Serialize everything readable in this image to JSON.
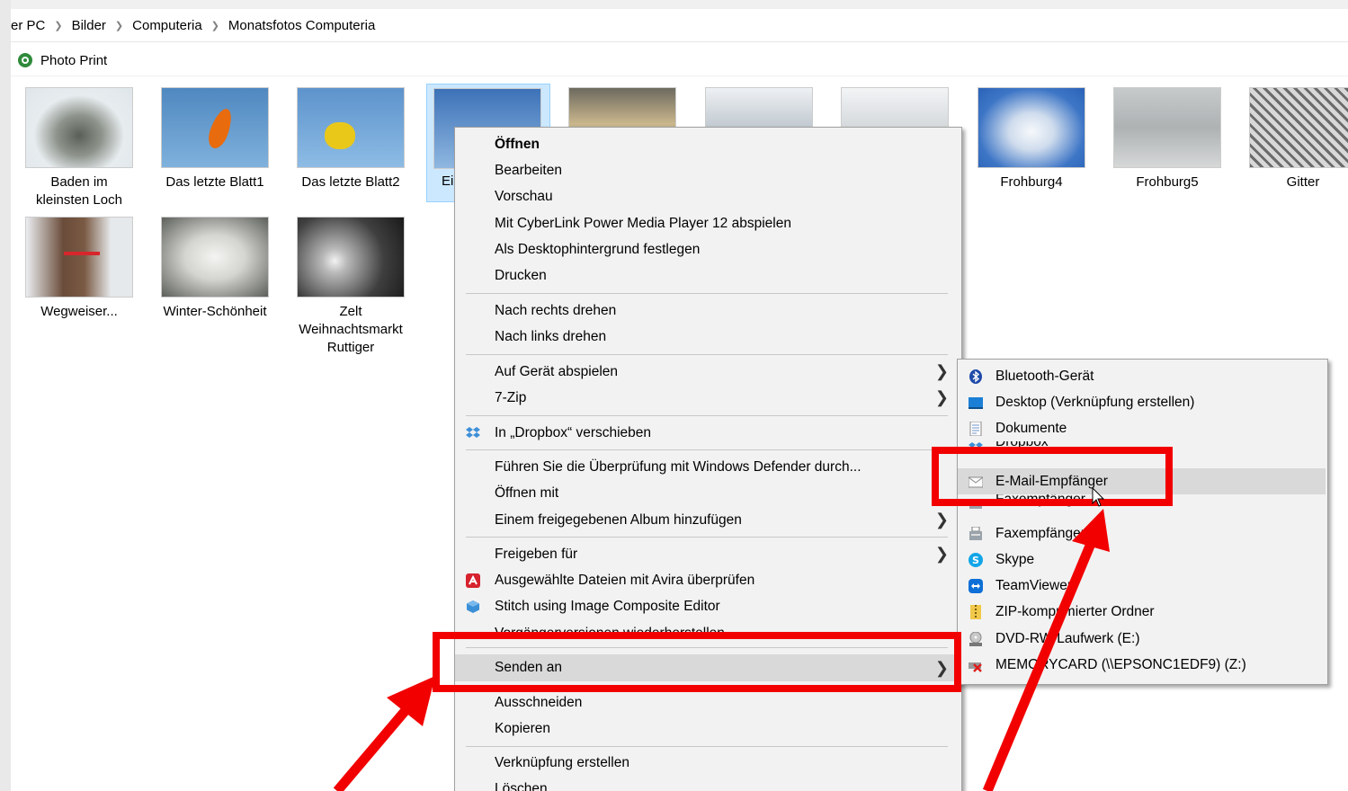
{
  "breadcrumb": [
    "er PC",
    "Bilder",
    "Computeria",
    "Monatsfotos Computeria"
  ],
  "toolbar": {
    "photo_print": "Photo Print"
  },
  "thumbnails": [
    {
      "caption": "Baden im kleinsten Loch"
    },
    {
      "caption": "Das letzte Blatt1"
    },
    {
      "caption": "Das letzte Blatt2"
    },
    {
      "caption": "Ei"
    },
    {
      "caption": ""
    },
    {
      "caption": ""
    },
    {
      "caption": ""
    },
    {
      "caption": "Frohburg4"
    },
    {
      "caption": "Frohburg5"
    },
    {
      "caption": "Gitter"
    },
    {
      "caption": "Wegweiser..."
    },
    {
      "caption": "Winter-Schönheit"
    },
    {
      "caption": "Zelt Weihnachtsmarkt Ruttiger"
    }
  ],
  "context_menu": {
    "items": [
      "Öffnen",
      "Bearbeiten",
      "Vorschau",
      "Mit CyberLink Power Media Player 12 abspielen",
      "Als Desktophintergrund festlegen",
      "Drucken",
      "Nach rechts drehen",
      "Nach links drehen",
      "Auf Gerät abspielen",
      "7-Zip",
      "In „Dropbox“ verschieben",
      "Führen Sie die Überprüfung mit Windows Defender durch...",
      "Öffnen mit",
      "Einem freigegebenen Album hinzufügen",
      "Freigeben für",
      "Ausgewählte Dateien mit Avira überprüfen",
      "Stitch using Image Composite Editor",
      "Vorgängerversionen wiederherstellen",
      "Senden an",
      "Ausschneiden",
      "Kopieren",
      "Verknüpfung erstellen",
      "Löschen"
    ]
  },
  "send_to_menu": {
    "items": [
      "Bluetooth-Gerät",
      "Desktop (Verknüpfung erstellen)",
      "Dokumente",
      "Dropbox",
      "E-Mail-Empfänger",
      "Faxempfänger",
      "Faxempfänger",
      "Skype",
      "TeamViewer",
      "ZIP-komprimierter Ordner",
      "DVD-RW-Laufwerk (E:)",
      "MEMORYCARD (\\\\EPSONC1EDF9) (Z:)"
    ]
  },
  "colors": {
    "annotation": "#f20000",
    "menu_bg": "#f2f2f2",
    "highlight": "#d9d9d9"
  }
}
